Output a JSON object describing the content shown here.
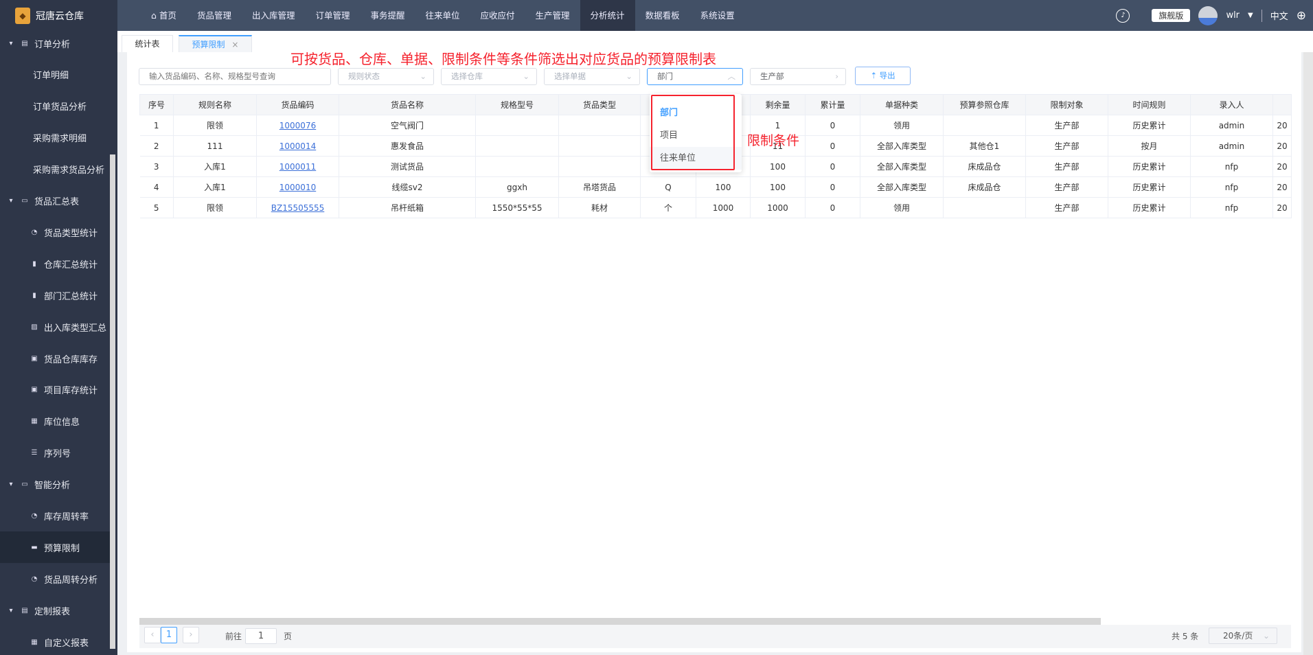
{
  "app": {
    "name": "冠唐云仓库"
  },
  "nav": {
    "items": [
      "首页",
      "货品管理",
      "出入库管理",
      "订单管理",
      "事务提醒",
      "往来单位",
      "应收应付",
      "生产管理",
      "分析统计",
      "数据看板",
      "系统设置"
    ],
    "active": "分析统计"
  },
  "user": {
    "edition": "旗舰版",
    "name": "wlr",
    "language": "中文"
  },
  "sidebar": [
    {
      "type": "group",
      "label": "订单分析",
      "icon": "document-icon"
    },
    {
      "type": "plain",
      "label": "订单明细"
    },
    {
      "type": "plain",
      "label": "订单货品分析"
    },
    {
      "type": "plain",
      "label": "采购需求明细"
    },
    {
      "type": "plain",
      "label": "采购需求货品分析"
    },
    {
      "type": "group",
      "label": "货品汇总表",
      "icon": "presentation-icon"
    },
    {
      "type": "child",
      "label": "货品类型统计",
      "icon": "pie-chart-icon"
    },
    {
      "type": "child",
      "label": "仓库汇总统计",
      "icon": "bar-chart-icon"
    },
    {
      "type": "child",
      "label": "部门汇总统计",
      "icon": "bar-chart-icon"
    },
    {
      "type": "child",
      "label": "出入库类型汇总",
      "icon": "line-chart-icon"
    },
    {
      "type": "child",
      "label": "货品仓库库存",
      "icon": "box-icon"
    },
    {
      "type": "child",
      "label": "项目库存统计",
      "icon": "box-icon"
    },
    {
      "type": "child",
      "label": "库位信息",
      "icon": "grid-icon"
    },
    {
      "type": "child",
      "label": "序列号",
      "icon": "list-icon"
    },
    {
      "type": "group",
      "label": "智能分析",
      "icon": "presentation-icon"
    },
    {
      "type": "child",
      "label": "库存周转率",
      "icon": "pie-chart-icon"
    },
    {
      "type": "child",
      "label": "预算限制",
      "icon": "monitor-icon",
      "active": true
    },
    {
      "type": "child",
      "label": "货品周转分析",
      "icon": "pie-chart-icon"
    },
    {
      "type": "group",
      "label": "定制报表",
      "icon": "document-icon"
    },
    {
      "type": "child",
      "label": "自定义报表",
      "icon": "grid-icon"
    }
  ],
  "tabs": [
    {
      "label": "统计表"
    },
    {
      "label": "预算限制",
      "close": "×",
      "active": true
    }
  ],
  "annotations": {
    "main": "可按货品、仓库、单据、限制条件等条件筛选出对应货品的预算限制表",
    "dropdown": "限制条件"
  },
  "filters": {
    "search_placeholder": "输入货品编码、名称、规格型号查询",
    "rule_status": "规则状态",
    "warehouse": "选择仓库",
    "document": "选择单据",
    "condition_type": "部门",
    "condition_value": "生产部",
    "export": "导出"
  },
  "dropdown": {
    "options": [
      "部门",
      "项目",
      "往来单位"
    ],
    "selected": "部门"
  },
  "table": {
    "headers": [
      "序号",
      "规则名称",
      "货品编码",
      "货品名称",
      "规格型号",
      "货品类型",
      "",
      "",
      "剩余量",
      "累计量",
      "单据种类",
      "预算参照仓库",
      "限制对象",
      "时间规则",
      "录入人",
      ""
    ],
    "rows": [
      [
        "1",
        "限领",
        "1000076",
        "空气阀门",
        "",
        "",
        "",
        "",
        "1",
        "0",
        "领用",
        "",
        "生产部",
        "历史累计",
        "admin",
        "20"
      ],
      [
        "2",
        "111",
        "1000014",
        "惠发食品",
        "",
        "",
        "",
        "",
        "11",
        "0",
        "全部入库类型",
        "其他仓1",
        "生产部",
        "按月",
        "admin",
        "20"
      ],
      [
        "3",
        "入库1",
        "1000011",
        "测试货品",
        "",
        "",
        "",
        "",
        "100",
        "0",
        "全部入库类型",
        "床成品仓",
        "生产部",
        "历史累计",
        "nfp",
        "20"
      ],
      [
        "4",
        "入库1",
        "1000010",
        "线缆sv2",
        "ggxh",
        "吊塔货品",
        "Q",
        "100",
        "100",
        "0",
        "全部入库类型",
        "床成品仓",
        "生产部",
        "历史累计",
        "nfp",
        "20"
      ],
      [
        "5",
        "限领",
        "BZ15505555",
        "吊杆纸箱",
        "1550*55*55",
        "耗材",
        "个",
        "1000",
        "1000",
        "0",
        "领用",
        "",
        "生产部",
        "历史累计",
        "nfp",
        "20"
      ]
    ]
  },
  "pagination": {
    "current": "1",
    "goto_label": "前往",
    "goto_value": "1",
    "page_label": "页",
    "total": "共 5 条",
    "page_size": "20条/页"
  }
}
